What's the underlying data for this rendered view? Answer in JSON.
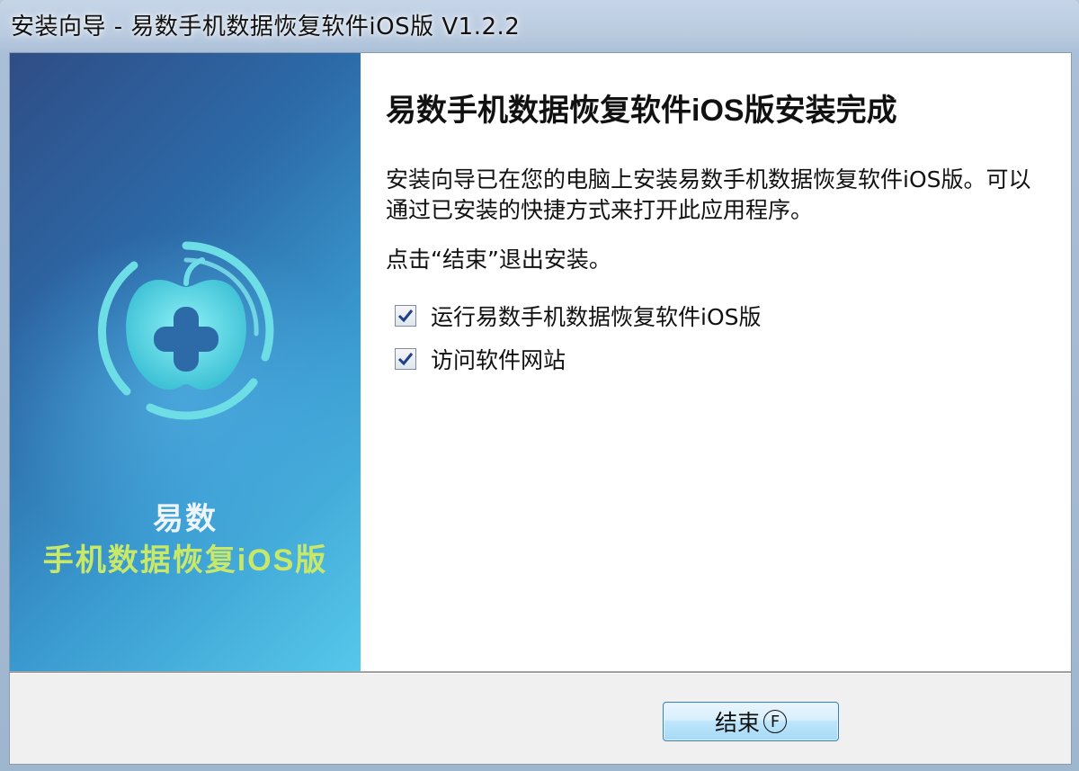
{
  "window": {
    "title": "安装向导 - 易数手机数据恢复软件iOS版 V1.2.2"
  },
  "banner": {
    "brand_line1": "易数",
    "brand_line2": "手机数据恢复iOS版",
    "logo_icon": "apple-plus-logo-icon"
  },
  "content": {
    "heading": "易数手机数据恢复软件iOS版安装完成",
    "description": "安装向导已在您的电脑上安装易数手机数据恢复软件iOS版。可以通过已安装的快捷方式来打开此应用程序。",
    "hint": "点击“结束”退出安装。",
    "options": [
      {
        "label": "运行易数手机数据恢复软件iOS版",
        "checked": true
      },
      {
        "label": "访问软件网站",
        "checked": true
      }
    ]
  },
  "footer": {
    "finish_label": "结束",
    "finish_accel": "F"
  },
  "colors": {
    "banner_dark": "#2f4d86",
    "banner_light": "#56c8ea",
    "brand_green": "#c8e86a",
    "button_border": "#3c7fb1"
  }
}
